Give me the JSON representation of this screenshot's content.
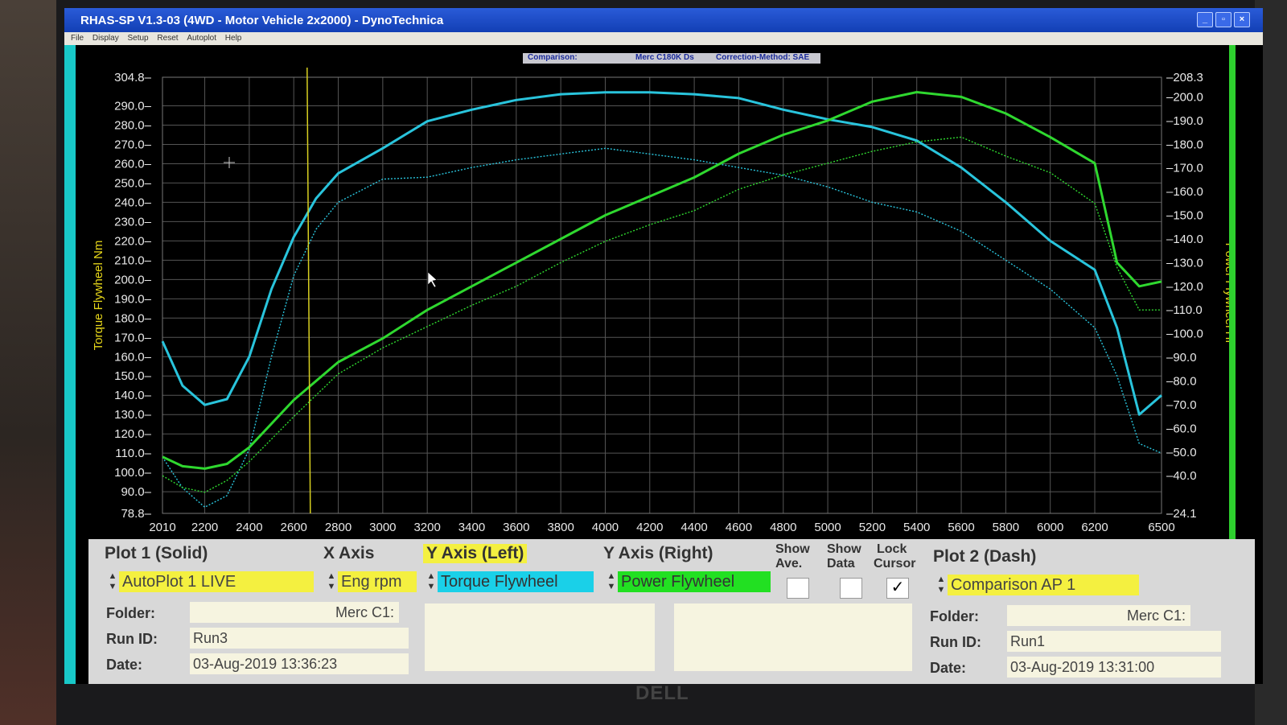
{
  "window": {
    "title": "RHAS-SP V1.3-03  (4WD - Motor Vehicle 2x2000) - DynoTechnica",
    "menu": [
      "File",
      "Display",
      "Setup",
      "Reset",
      "Autoplot",
      "Help"
    ]
  },
  "infobar": {
    "comparison_label": "Comparison:",
    "comparison_value": "Merc C180K Ds",
    "correction": "Correction-Method: SAE"
  },
  "chart_data": {
    "type": "line",
    "ylabel_left": "Torque Flywheel Nm",
    "ylabel_right": "Power Flywheel HP",
    "x_ticks": [
      "2010",
      "2200",
      "2400",
      "2600",
      "2800",
      "3000",
      "3200",
      "3400",
      "3600",
      "3800",
      "4000",
      "4200",
      "4400",
      "4600",
      "4800",
      "5000",
      "5200",
      "5400",
      "5600",
      "5800",
      "6000",
      "6200",
      "6500"
    ],
    "xlim": [
      2010,
      6500
    ],
    "ylim_left": [
      78.8,
      304.8
    ],
    "ylim_right": [
      24.1,
      208.3
    ],
    "y_left_ticks": [
      "304.8",
      "290.0",
      "280.0",
      "270.0",
      "260.0",
      "250.0",
      "240.0",
      "230.0",
      "220.0",
      "210.0",
      "200.0",
      "190.0",
      "180.0",
      "170.0",
      "160.0",
      "150.0",
      "140.0",
      "130.0",
      "120.0",
      "110.0",
      "100.0",
      "90.0",
      "78.8"
    ],
    "y_right_ticks": [
      "208.3",
      "200.0",
      "190.0",
      "180.0",
      "170.0",
      "160.0",
      "150.0",
      "140.0",
      "130.0",
      "120.0",
      "110.0",
      "100.0",
      "90.0",
      "80.0",
      "70.0",
      "60.0",
      "50.0",
      "40.0",
      "24.1"
    ],
    "cursor_x": 2660,
    "series": [
      {
        "name": "Torque Flywheel",
        "plot": "AutoPlot 1 LIVE",
        "axis": "left",
        "style": "solid",
        "color": "#29c4dc",
        "x": [
          2010,
          2100,
          2200,
          2300,
          2400,
          2500,
          2600,
          2700,
          2800,
          3000,
          3200,
          3400,
          3600,
          3800,
          4000,
          4200,
          4400,
          4600,
          4800,
          5000,
          5200,
          5400,
          5600,
          5800,
          6000,
          6200,
          6300,
          6400,
          6500
        ],
        "y": [
          168,
          145,
          135,
          138,
          160,
          195,
          222,
          242,
          255,
          268,
          282,
          288,
          293,
          296,
          297,
          297,
          296,
          294,
          288,
          283,
          279,
          272,
          258,
          240,
          220,
          205,
          175,
          130,
          140
        ]
      },
      {
        "name": "Torque Flywheel",
        "plot": "Comparison AP 1",
        "axis": "left",
        "style": "dash",
        "color": "#29c4dc",
        "x": [
          2010,
          2100,
          2200,
          2300,
          2400,
          2500,
          2600,
          2700,
          2800,
          3000,
          3200,
          3400,
          3600,
          3800,
          4000,
          4200,
          4400,
          4600,
          4800,
          5000,
          5200,
          5400,
          5600,
          5800,
          6000,
          6200,
          6300,
          6400,
          6500
        ],
        "y": [
          108,
          92,
          82,
          88,
          112,
          160,
          202,
          226,
          240,
          252,
          253,
          258,
          262,
          265,
          268,
          265,
          262,
          258,
          254,
          248,
          240,
          235,
          225,
          210,
          195,
          175,
          150,
          115,
          110
        ]
      },
      {
        "name": "Power Flywheel",
        "plot": "AutoPlot 1 LIVE",
        "axis": "right",
        "style": "solid",
        "color": "#2fd82f",
        "x": [
          2010,
          2100,
          2200,
          2300,
          2400,
          2600,
          2800,
          3000,
          3200,
          3400,
          3600,
          3800,
          4000,
          4200,
          4400,
          4600,
          4800,
          5000,
          5200,
          5400,
          5600,
          5800,
          6000,
          6200,
          6300,
          6400,
          6500
        ],
        "y": [
          48,
          44,
          43,
          45,
          52,
          72,
          88,
          98,
          110,
          120,
          130,
          140,
          150,
          158,
          166,
          176,
          184,
          190,
          198,
          202,
          200,
          193,
          183,
          172,
          130,
          120,
          122
        ]
      },
      {
        "name": "Power Flywheel",
        "plot": "Comparison AP 1",
        "axis": "right",
        "style": "dash",
        "color": "#2fd82f",
        "x": [
          2010,
          2100,
          2200,
          2300,
          2400,
          2600,
          2800,
          3000,
          3200,
          3400,
          3600,
          3800,
          4000,
          4200,
          4400,
          4600,
          4800,
          5000,
          5200,
          5400,
          5600,
          5800,
          6000,
          6200,
          6300,
          6400,
          6500
        ],
        "y": [
          40,
          35,
          33,
          38,
          46,
          65,
          83,
          94,
          103,
          112,
          120,
          130,
          139,
          146,
          152,
          161,
          167,
          172,
          177,
          181,
          183,
          175,
          168,
          155,
          128,
          110,
          110
        ]
      }
    ]
  },
  "panel": {
    "plot1": {
      "header": "Plot 1 (Solid)",
      "select": "AutoPlot 1 LIVE",
      "folder_label": "Folder:",
      "folder_value": "Merc C1:",
      "runid_label": "Run ID:",
      "runid_value": "Run3",
      "date_label": "Date:",
      "date_value": "03-Aug-2019  13:36:23"
    },
    "xaxis": {
      "header": "X Axis",
      "select": "Eng rpm"
    },
    "yleft": {
      "header": "Y Axis (Left)",
      "select": "Torque Flywheel"
    },
    "yright": {
      "header": "Y Axis (Right)",
      "select": "Power Flywheel"
    },
    "show_ave": {
      "line1": "Show",
      "line2": "Ave.",
      "checked": false
    },
    "show_data": {
      "line1": "Show",
      "line2": "Data",
      "checked": false
    },
    "lock_cursor": {
      "line1": "Lock",
      "line2": "Cursor",
      "checked": true,
      "mark": "✓"
    },
    "plot2": {
      "header": "Plot 2 (Dash)",
      "select": "Comparison AP 1",
      "folder_label": "Folder:",
      "folder_value": "Merc C1:",
      "runid_label": "Run ID:",
      "runid_value": "Run1",
      "date_label": "Date:",
      "date_value": "03-Aug-2019  13:31:00"
    }
  },
  "monitor_brand": "DELL",
  "colors": {
    "torque": "#29c4dc",
    "power": "#2fd82f",
    "cursor": "#d8d020",
    "yellow_field": "#f4f040",
    "cyan_field": "#1ad0e8",
    "green_field": "#22e022"
  }
}
